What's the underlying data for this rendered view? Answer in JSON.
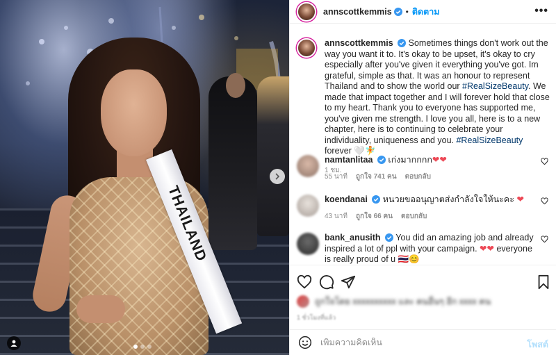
{
  "photo": {
    "sash_text": "THAILAND",
    "carousel_dots": 3,
    "active_dot": 0
  },
  "header": {
    "username": "annscottkemmis",
    "separator": "•",
    "follow_label": "ติดตาม",
    "more_label": "•••"
  },
  "caption": {
    "username": "annscottkemmis",
    "text_part1": " Sometimes things don't work out the way you want it to. It's okay to be upset, it's okay to cry especially after you've given it everything you've got. Im grateful, simple as that. It was an honour to represent Thailand and to show the world our ",
    "hashtag1": "#RealSizeBeauty",
    "text_part2": ". We made that impact together and I will forever hold that close to my heart. Thank you to everyone has supported me, you've given me strength. I love you all, here is to a new chapter, here is to continuing to celebrate your individuality, uniqueness and you. ",
    "hashtag2": "#RealSizeBeauty",
    "text_part3": " forever 🤍🧚",
    "time": "1 ชม."
  },
  "comments": [
    {
      "username": "namtanlitaa",
      "text": " เก่งมากกกก",
      "hearts": "❤❤",
      "time": "55 นาที",
      "likes": "ถูกใจ 741 คน",
      "reply_label": "ตอบกลับ"
    },
    {
      "username": "koendanai",
      "text": " หนวยขออนุญาตส่งกำลังใจให้นะคะ",
      "hearts": "❤",
      "time": "43 นาที",
      "likes": "ถูกใจ 66 คน",
      "reply_label": "ตอบกลับ"
    },
    {
      "username": "bank_anusith",
      "text": " You did an amazing job and already inspired a lot of ppl with your campaign. ",
      "hearts": "❤❤",
      "text2": " everyone is really proud of u 🇹🇭😊"
    }
  ],
  "likes": {
    "text": "ถูกใจโดย xxxxxxxxxx และ คนอื่นๆ อีก xxxx คน"
  },
  "post_time": "1 ชั่วโมงที่แล้ว",
  "composer": {
    "placeholder": "เพิ่มความคิดเห็น",
    "post_label": "โพสต์"
  },
  "colors": {
    "accent": "#0095f6",
    "heart": "#ed4956",
    "hashtag": "#00376b",
    "muted": "#8e8e8e",
    "post_disabled": "#b2dffc"
  },
  "icons": {
    "verified": "verified-badge-icon",
    "like": "heart-outline-icon",
    "comment": "speech-bubble-icon",
    "share": "paper-plane-icon",
    "save": "bookmark-icon",
    "emoji": "smiley-icon",
    "tag": "person-tag-icon",
    "next": "chevron-right-icon"
  }
}
